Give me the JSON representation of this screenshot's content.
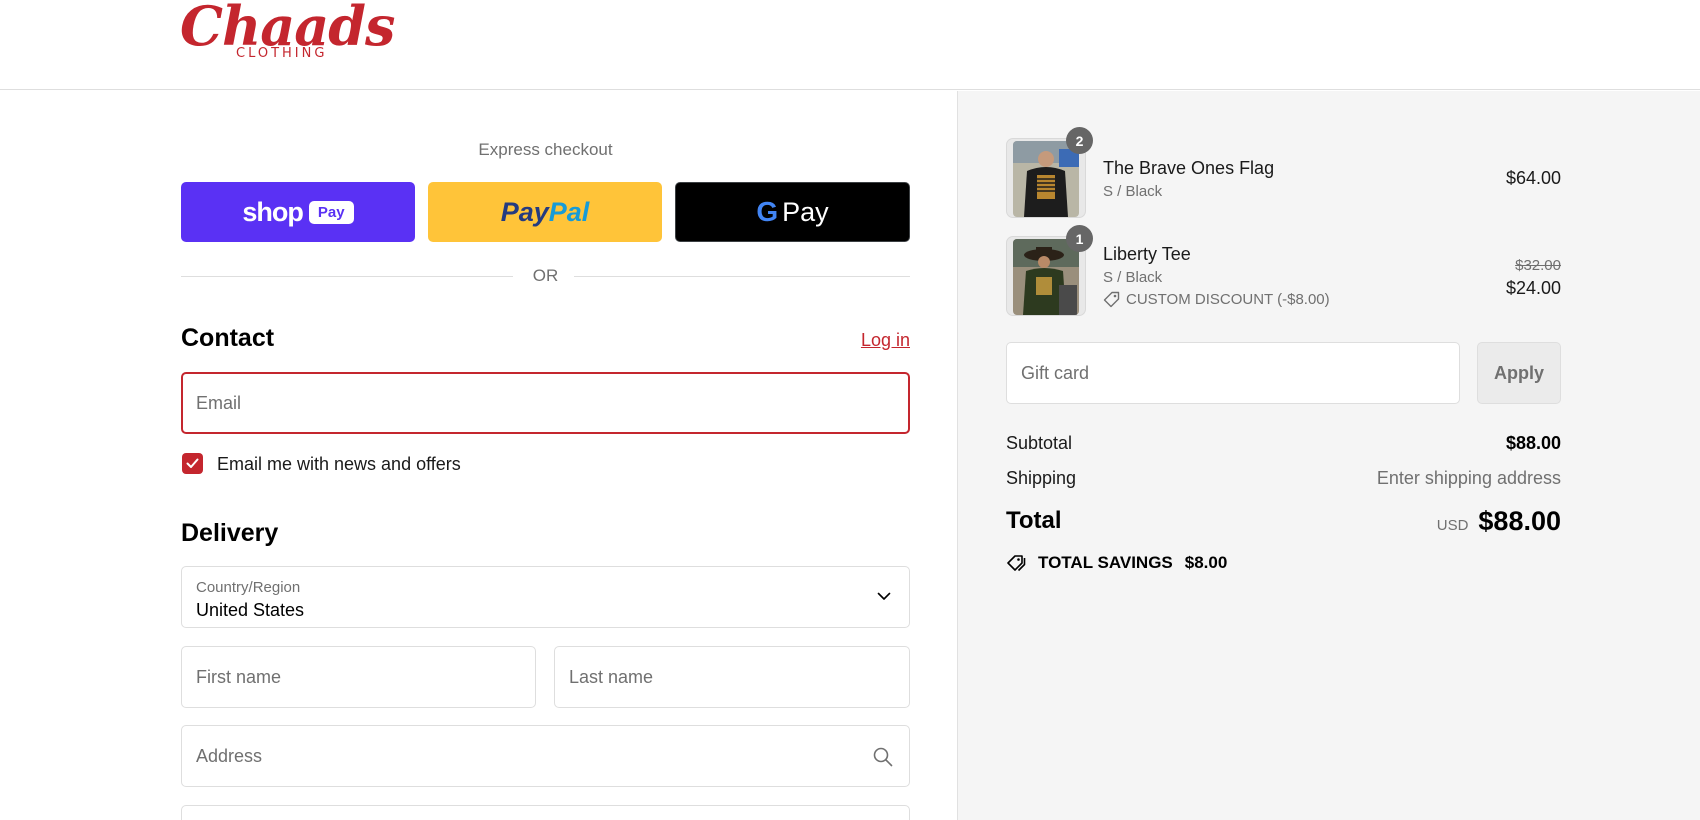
{
  "brand": {
    "script": "Chaads",
    "sub": "CLOTHING",
    "color": "#c4262e"
  },
  "express": {
    "title": "Express checkout",
    "shop_pay": {
      "text": "shop",
      "pill": "Pay"
    },
    "paypal": {
      "pay": "Pay",
      "pal": "Pal"
    },
    "gpay": {
      "g": "G",
      "text": "Pay"
    }
  },
  "or_text": "OR",
  "contact": {
    "title": "Contact",
    "login": "Log in",
    "email_placeholder": "Email",
    "newsletter_label": "Email me with news and offers",
    "newsletter_checked": true
  },
  "delivery": {
    "title": "Delivery",
    "country_label": "Country/Region",
    "country_value": "United States",
    "first_name_placeholder": "First name",
    "last_name_placeholder": "Last name",
    "address_placeholder": "Address"
  },
  "cart": {
    "items": [
      {
        "name": "The Brave Ones Flag",
        "variant": "S / Black",
        "qty": "2",
        "price": "$64.00"
      },
      {
        "name": "Liberty Tee",
        "variant": "S / Black",
        "qty": "1",
        "original_price": "$32.00",
        "price": "$24.00",
        "discount": "CUSTOM DISCOUNT (-$8.00)"
      }
    ],
    "gift_card_placeholder": "Gift card",
    "apply_label": "Apply",
    "subtotal_label": "Subtotal",
    "subtotal_value": "$88.00",
    "shipping_label": "Shipping",
    "shipping_value": "Enter shipping address",
    "total_label": "Total",
    "currency": "USD",
    "total_value": "$88.00",
    "savings_label": "TOTAL SAVINGS",
    "savings_value": "$8.00"
  }
}
